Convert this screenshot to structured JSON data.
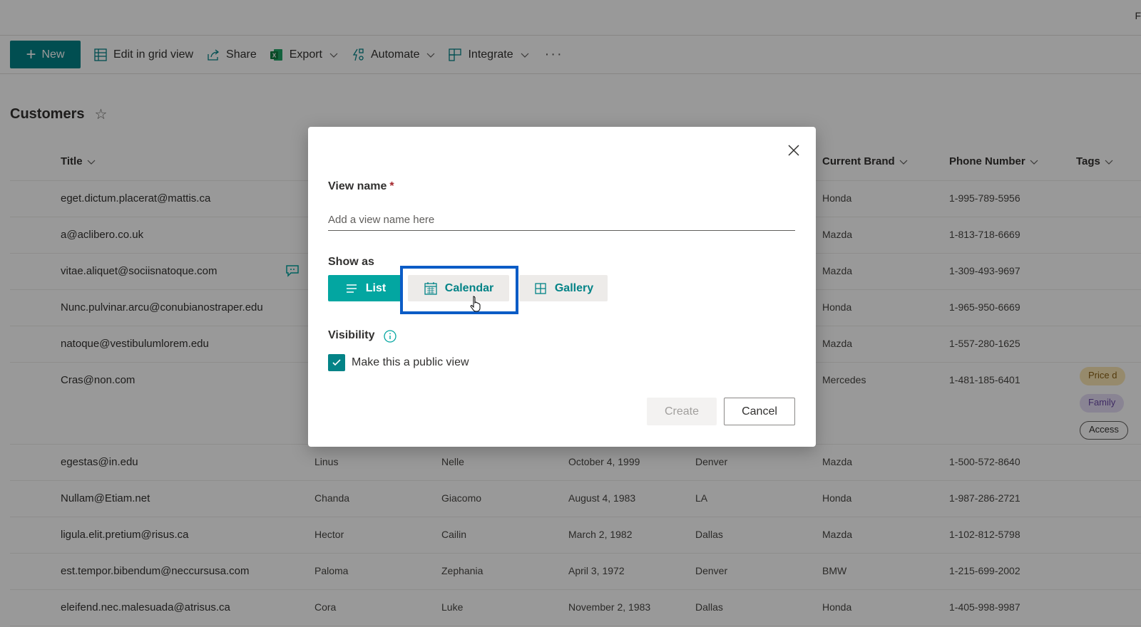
{
  "topbar": {
    "corner_letter": "F"
  },
  "commandbar": {
    "new_label": "New",
    "items": [
      {
        "label": "Edit in grid view",
        "icon": "grid-icon"
      },
      {
        "label": "Share",
        "icon": "share-icon"
      },
      {
        "label": "Export",
        "icon": "excel-icon",
        "has_dropdown": true
      },
      {
        "label": "Automate",
        "icon": "automate-icon",
        "has_dropdown": true
      },
      {
        "label": "Integrate",
        "icon": "integrate-icon",
        "has_dropdown": true
      }
    ],
    "more_label": "···"
  },
  "list": {
    "title": "Customers",
    "favorite_icon": "star-icon",
    "columns": [
      "Title",
      "Current Brand",
      "Phone Number",
      "Tags"
    ],
    "rows_top": [
      {
        "title": "eget.dictum.placerat@mattis.ca",
        "brand": "Honda",
        "phone": "1-995-789-5956"
      },
      {
        "title": "a@aclibero.co.uk",
        "brand": "Mazda",
        "phone": "1-813-718-6669"
      },
      {
        "title": "vitae.aliquet@sociisnatoque.com",
        "brand": "Mazda",
        "phone": "1-309-493-9697",
        "has_comment": true
      },
      {
        "title": "Nunc.pulvinar.arcu@conubianostraper.edu",
        "brand": "Honda",
        "phone": "1-965-950-6669"
      },
      {
        "title": "natoque@vestibulumlorem.edu",
        "brand": "Mazda",
        "phone": "1-557-280-1625"
      },
      {
        "title": "Cras@non.com",
        "brand": "Mercedes",
        "phone": "1-481-185-6401",
        "tags": [
          "Price d",
          "Family",
          "Access"
        ]
      }
    ],
    "rows_bottom": [
      {
        "title": "egestas@in.edu",
        "first": "Linus",
        "last": "Nelle",
        "date": "October 4, 1999",
        "city": "Denver",
        "brand": "Mazda",
        "phone": "1-500-572-8640"
      },
      {
        "title": "Nullam@Etiam.net",
        "first": "Chanda",
        "last": "Giacomo",
        "date": "August 4, 1983",
        "city": "LA",
        "brand": "Honda",
        "phone": "1-987-286-2721"
      },
      {
        "title": "ligula.elit.pretium@risus.ca",
        "first": "Hector",
        "last": "Cailin",
        "date": "March 2, 1982",
        "city": "Dallas",
        "brand": "Mazda",
        "phone": "1-102-812-5798"
      },
      {
        "title": "est.tempor.bibendum@neccursusa.com",
        "first": "Paloma",
        "last": "Zephania",
        "date": "April 3, 1972",
        "city": "Denver",
        "brand": "BMW",
        "phone": "1-215-699-2002"
      },
      {
        "title": "eleifend.nec.malesuada@atrisus.ca",
        "first": "Cora",
        "last": "Luke",
        "date": "November 2, 1983",
        "city": "Dallas",
        "brand": "Honda",
        "phone": "1-405-998-9987"
      }
    ]
  },
  "dialog": {
    "view_name_label": "View name",
    "required_mark": "*",
    "view_name_value": "",
    "view_name_placeholder": "Add a view name here",
    "show_as_label": "Show as",
    "show_as_options": [
      "List",
      "Calendar",
      "Gallery"
    ],
    "show_as_selected": "List",
    "visibility_label": "Visibility",
    "public_view_label": "Make this a public view",
    "public_view_checked": true,
    "create_label": "Create",
    "create_disabled": true,
    "cancel_label": "Cancel"
  },
  "colors": {
    "accent": "#038387",
    "selected_segment": "#03a6a1",
    "highlight_box": "#0b5cc6",
    "tag_yellow": "#fbe7b5",
    "tag_purple": "#e5dcf5"
  }
}
